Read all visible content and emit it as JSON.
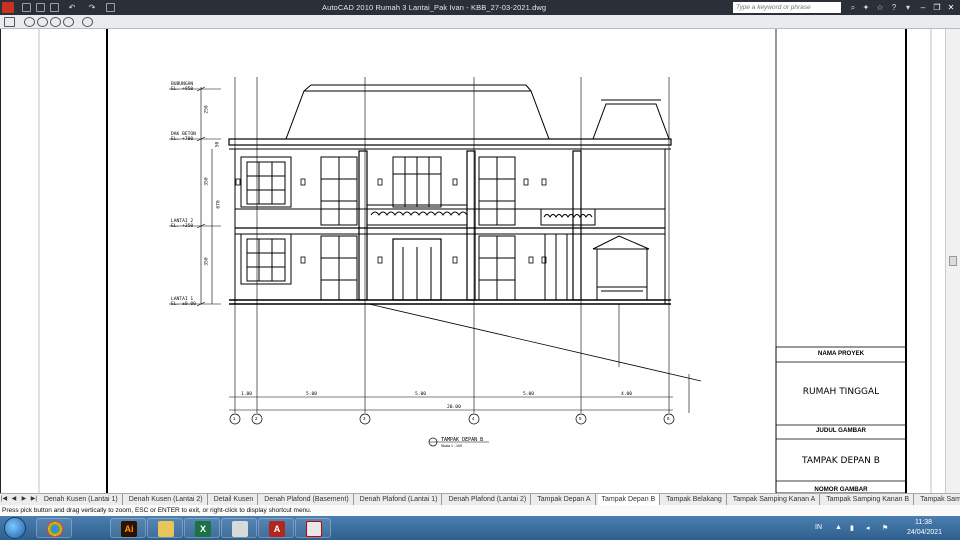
{
  "titlebar": {
    "title": "AutoCAD 2010     Rumah 3 Lantai_Pak Ivan - KBB_27-03-2021.dwg",
    "search_placeholder": "Type a keyword or phrase"
  },
  "drawing": {
    "levels": [
      {
        "name": "BUBUNGAN",
        "elevation": "EL. +950"
      },
      {
        "name": "DAK BETON",
        "elevation": "EL. +700"
      },
      {
        "name": "LANTAI 2",
        "elevation": "EL. +350"
      },
      {
        "name": "LANTAI 1",
        "elevation": "EL. ±0.00"
      }
    ],
    "vertical_dims": [
      "250",
      "350",
      "350"
    ],
    "vertical_dims_small": [
      "50",
      "670"
    ],
    "horizontal_dims": [
      "1.00",
      "5.00",
      "5.00",
      "5.00",
      "4.00"
    ],
    "total_dim": "20.00",
    "axis_labels": [
      "1",
      "2",
      "3",
      "4",
      "5",
      "6"
    ],
    "view_title": "TAMPAK DEPAN B",
    "view_scale": "Skala 1 : 100",
    "title_block": {
      "project_header": "NAMA PROYEK",
      "project_name": "RUMAH TINGGAL",
      "drawing_header": "JUDUL GAMBAR",
      "drawing_name": "TAMPAK DEPAN B",
      "number_header": "NOMOR GAMBAR"
    }
  },
  "tabs": [
    "Denah Kusen (Lantai 1)",
    "Denah Kusen (Lantai 2)",
    "Detail Kusen",
    "Denah Plafond (Basement)",
    "Denah Plafond (Lantai 1)",
    "Denah Plafond (Lantai 2)",
    "Tampak Depan A",
    "Tampak Depan B",
    "Tampak Belakang",
    "Tampak Samping Kanan A",
    "Tampak Samping Kanan B",
    "Tampak Samping Kiri"
  ],
  "active_tab": "Tampak Depan B",
  "command_line": "Press pick button and drag vertically to zoom, ESC or ENTER to exit, or right-click to display shortcut menu.",
  "taskbar": {
    "language": "IN",
    "time": "11:38",
    "date": "24/04/2021",
    "apps": [
      {
        "icon": "chrome-icon",
        "glyph": ""
      },
      {
        "icon": "illustrator-icon",
        "glyph": "Ai"
      },
      {
        "icon": "folder-icon",
        "glyph": ""
      },
      {
        "icon": "excel-icon",
        "glyph": "X"
      },
      {
        "icon": "paint-icon",
        "glyph": ""
      },
      {
        "icon": "autocad-icon",
        "glyph": "A"
      },
      {
        "icon": "pdf-icon",
        "glyph": ""
      }
    ]
  },
  "colors": {
    "titlebar": "#2b2f38",
    "canvas": "#ffffff",
    "linework": "#000000",
    "taskbar": "#3a6d9e"
  }
}
